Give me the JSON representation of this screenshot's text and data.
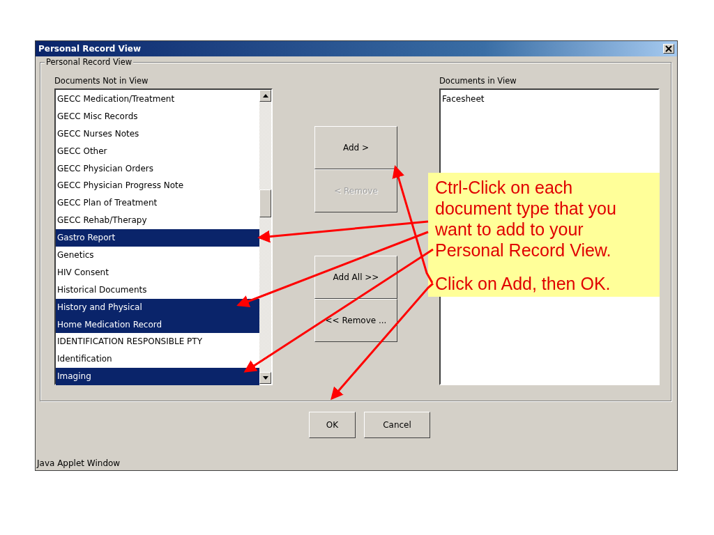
{
  "window": {
    "title": "Personal Record View"
  },
  "group": {
    "title": "Personal Record View"
  },
  "available": {
    "label": "Documents Not in View",
    "items": [
      {
        "text": "GECC Medication/Treatment",
        "selected": false
      },
      {
        "text": "GECC Misc Records",
        "selected": false
      },
      {
        "text": "GECC Nurses Notes",
        "selected": false
      },
      {
        "text": "GECC Other",
        "selected": false
      },
      {
        "text": "GECC Physician Orders",
        "selected": false
      },
      {
        "text": "GECC Physician Progress Note",
        "selected": false
      },
      {
        "text": "GECC Plan of Treatment",
        "selected": false
      },
      {
        "text": "GECC Rehab/Therapy",
        "selected": false
      },
      {
        "text": "Gastro Report",
        "selected": true
      },
      {
        "text": "Genetics",
        "selected": false
      },
      {
        "text": "HIV Consent",
        "selected": false
      },
      {
        "text": "Historical Documents",
        "selected": false
      },
      {
        "text": "History and Physical",
        "selected": true
      },
      {
        "text": "Home Medication Record",
        "selected": true
      },
      {
        "text": "IDENTIFICATION RESPONSIBLE PTY",
        "selected": false
      },
      {
        "text": "Identification",
        "selected": false
      },
      {
        "text": "Imaging",
        "selected": true
      }
    ]
  },
  "move_buttons": [
    {
      "label": "Add >",
      "disabled": false
    },
    {
      "label": "< Remove",
      "disabled": true
    },
    {
      "label": "Add All >>",
      "disabled": false
    },
    {
      "label": "<< Remove ...",
      "disabled": false
    }
  ],
  "in_view": {
    "label": "Documents in View",
    "items": [
      {
        "text": "Facesheet",
        "selected": false
      }
    ]
  },
  "dialog_buttons": [
    "OK",
    "Cancel"
  ],
  "status_bar": "Java Applet Window",
  "callout": [
    "Ctrl-Click on each document type that you want to add to your Personal Record View.",
    "Click on Add, then OK."
  ]
}
